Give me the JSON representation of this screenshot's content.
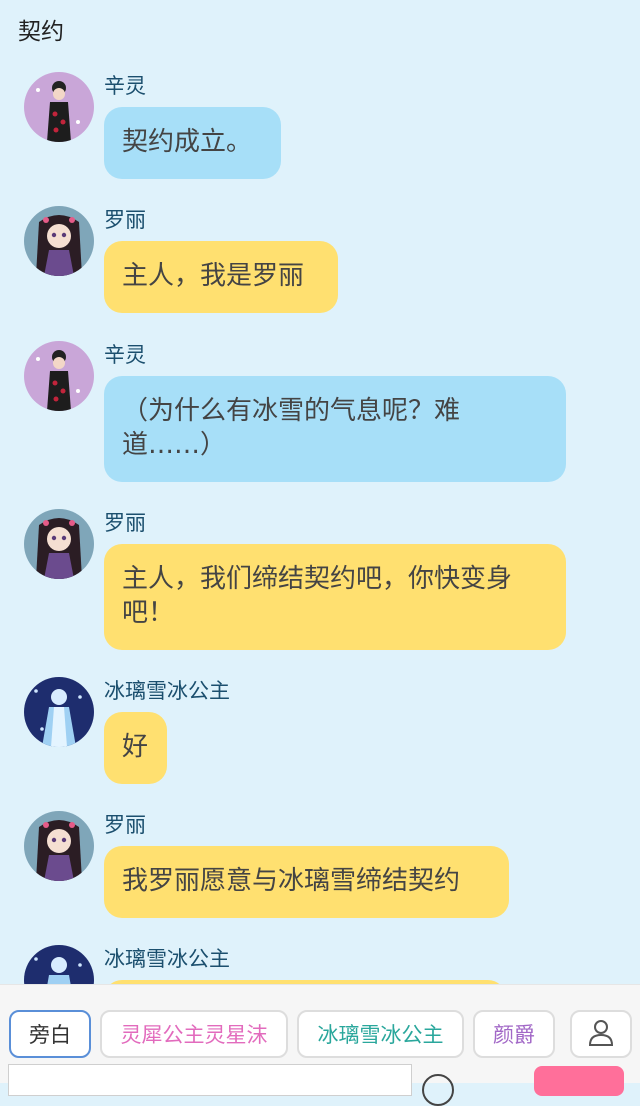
{
  "header": {
    "title": "契约"
  },
  "messages": [
    {
      "speaker": "辛灵",
      "text": "契约成立。",
      "style": "blue"
    },
    {
      "speaker": "罗丽",
      "text": "主人，我是罗丽",
      "style": "yellow"
    },
    {
      "speaker": "辛灵",
      "text": "（为什么有冰雪的气息呢？难道……）",
      "style": "blue"
    },
    {
      "speaker": "罗丽",
      "text": "主人，我们缔结契约吧，你快变身吧！",
      "style": "yellow"
    },
    {
      "speaker": "冰璃雪冰公主",
      "text": "好",
      "style": "yellow"
    },
    {
      "speaker": "罗丽",
      "text": "我罗丽愿意与冰璃雪缔结契约",
      "style": "yellow"
    },
    {
      "speaker": "冰璃雪冰公主",
      "text": "",
      "style": "yellow"
    }
  ],
  "character_bar": {
    "chips": [
      {
        "label": "旁白",
        "color": "#333333",
        "active": true
      },
      {
        "label": "灵犀公主灵星沫",
        "color": "#e26bbd"
      },
      {
        "label": "冰璃雪冰公主",
        "color": "#2aa79c"
      },
      {
        "label": "颜爵",
        "color": "#a268c7"
      }
    ]
  },
  "icons": {
    "character_avatar": "person-icon"
  },
  "colors": {
    "background": "#dff2fb",
    "bubble_blue": "#a7dff8",
    "bubble_yellow": "#ffe070",
    "send_button": "#ff6f9a"
  }
}
